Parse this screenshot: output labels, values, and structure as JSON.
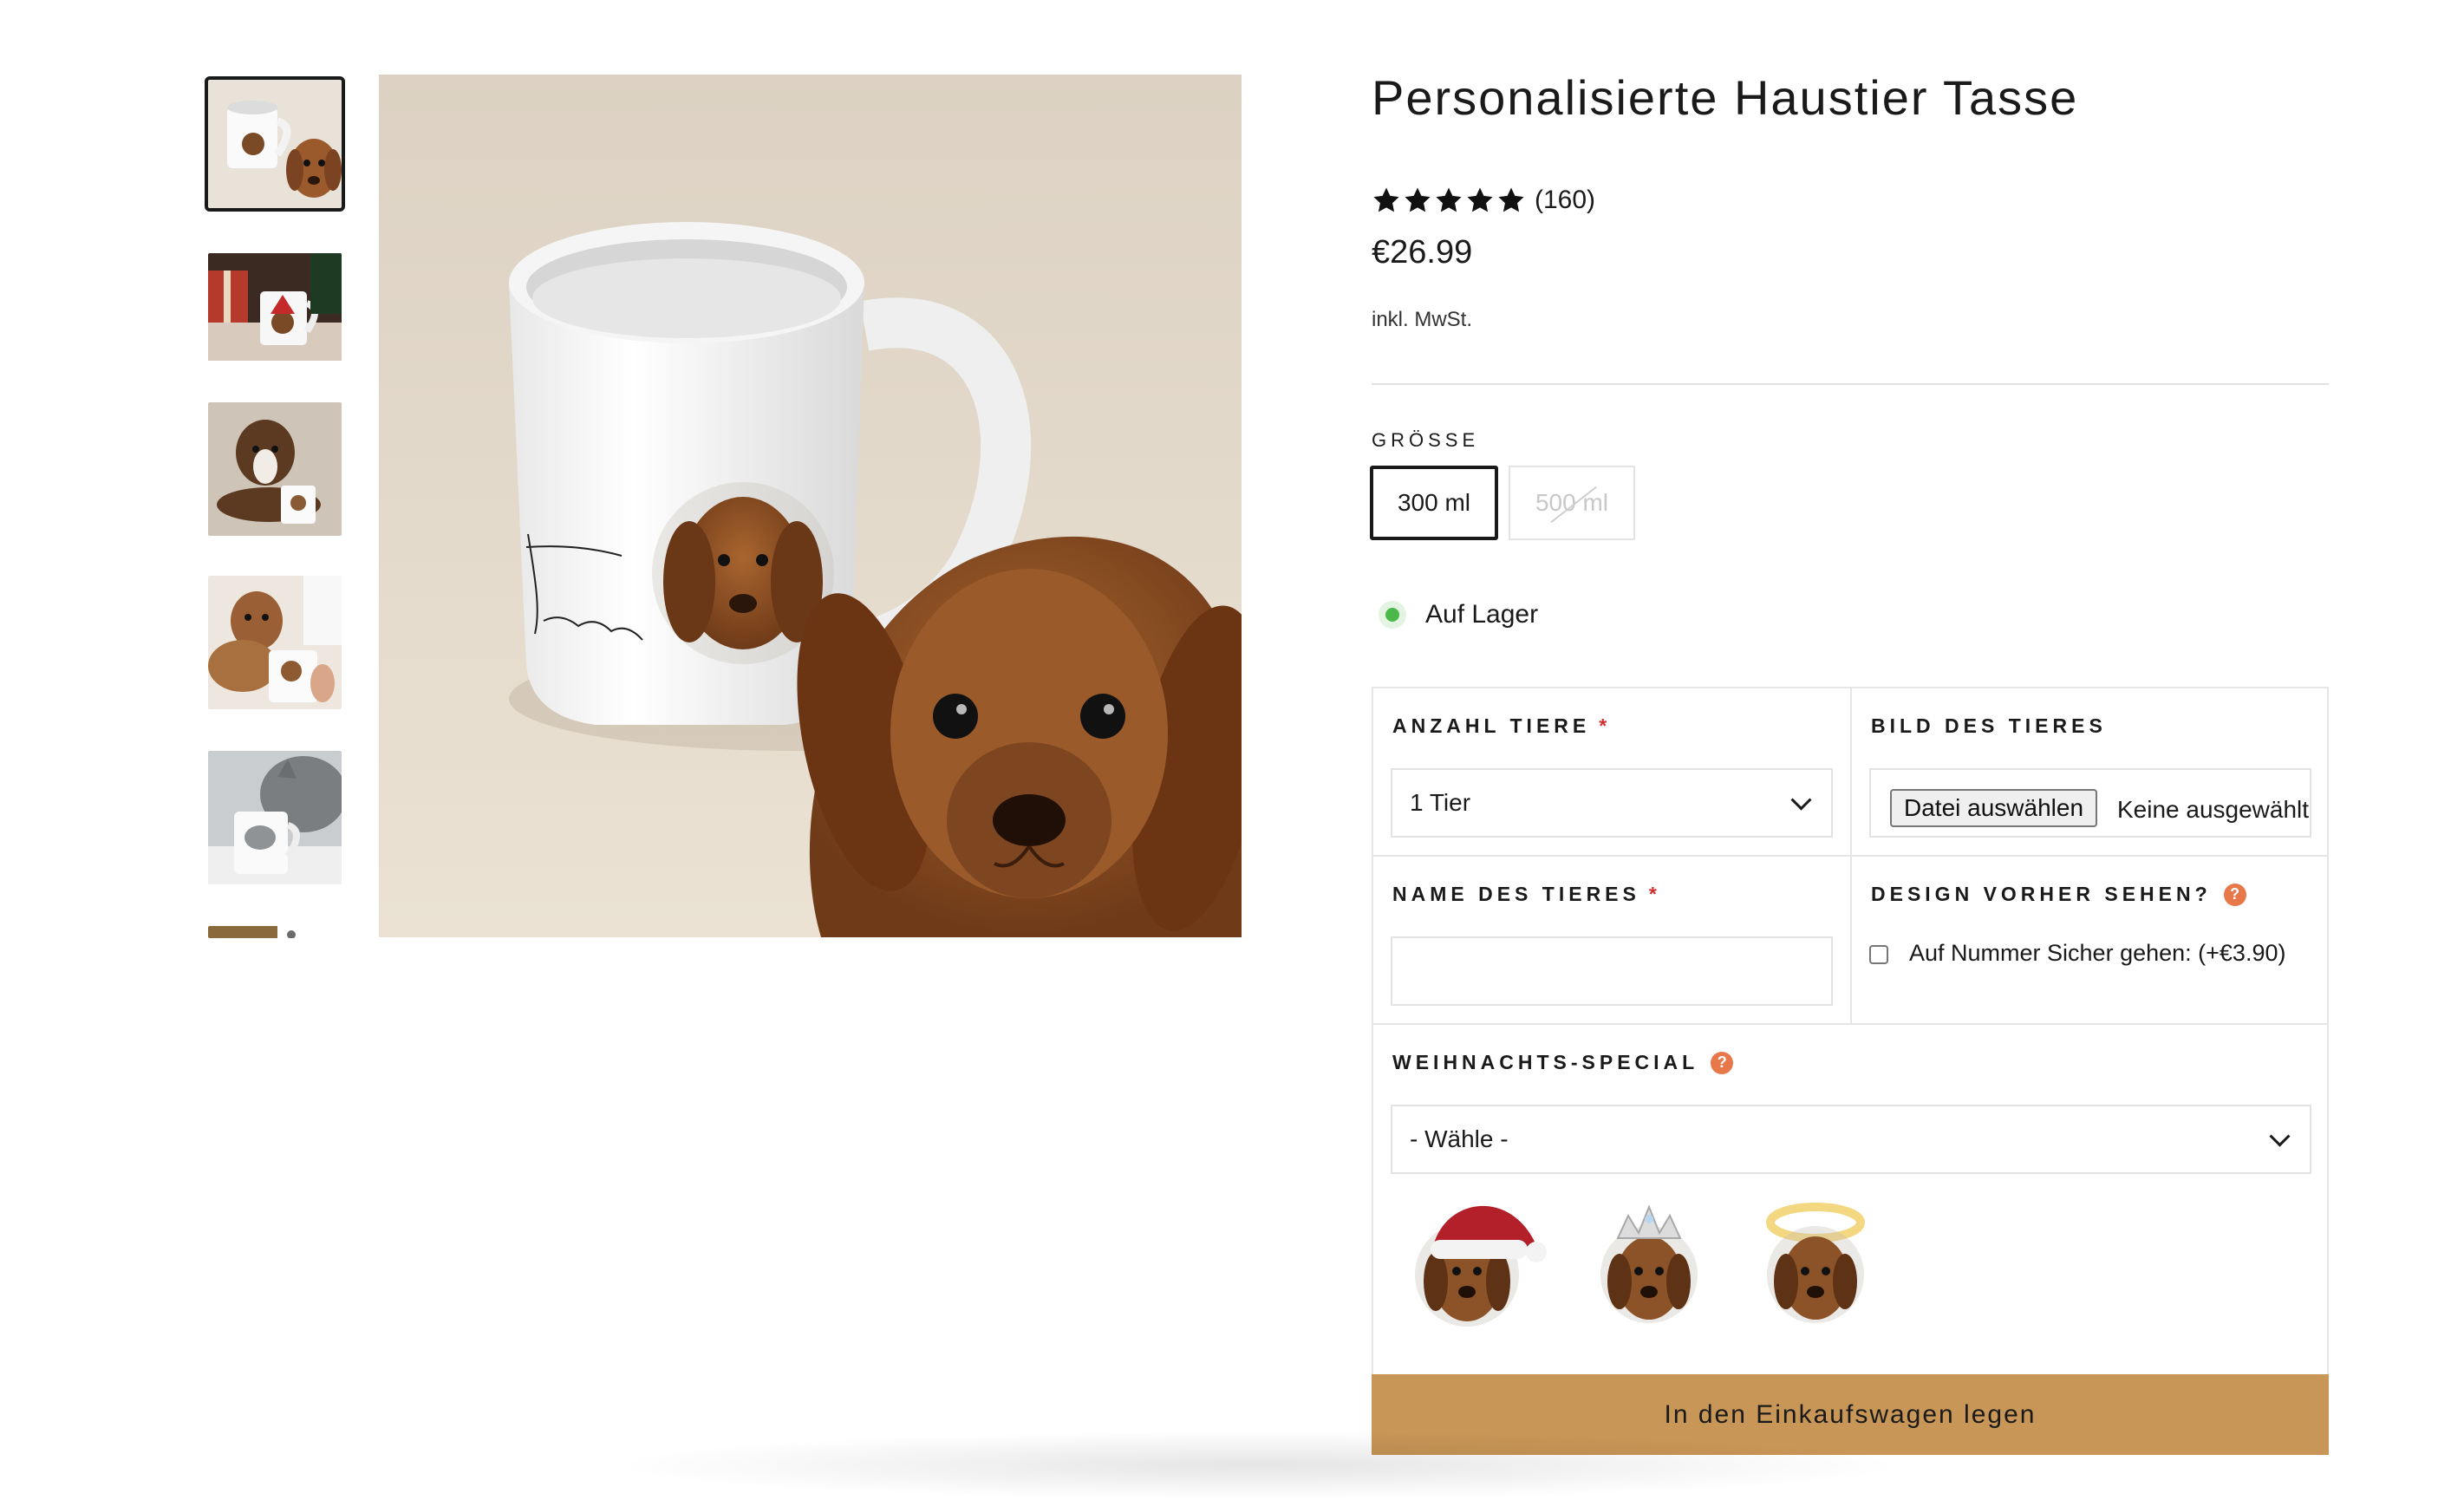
{
  "product": {
    "title": "Personalisierte Haustier Tasse",
    "rating": 5,
    "review_count": "(160)",
    "price": "€26.99",
    "tax_note": "inkl. MwSt."
  },
  "size": {
    "label": "GRÖSSE",
    "options": [
      {
        "label": "300 ml",
        "selected": true,
        "available": true
      },
      {
        "label": "500 ml",
        "selected": false,
        "available": false
      }
    ]
  },
  "stock": {
    "label": "Auf Lager",
    "color": "#4cb84a"
  },
  "options": {
    "pet_count": {
      "label": "ANZAHL TIERE",
      "required_mark": "*",
      "value": "1 Tier"
    },
    "pet_image": {
      "label": "BILD DES TIERES",
      "button_label": "Datei auswählen",
      "no_file_text": "Keine ausgewählt"
    },
    "pet_name": {
      "label": "NAME DES TIERES",
      "required_mark": "*",
      "value": ""
    },
    "preview": {
      "label": "DESIGN VORHER SEHEN?",
      "help_icon": "?",
      "checkbox_label": "Auf Nummer Sicher gehen: (+€3.90)",
      "checked": false
    },
    "christmas": {
      "label": "WEIHNACHTS-SPECIAL",
      "help_icon": "?",
      "value": "- Wähle -"
    }
  },
  "specials": [
    "santa-hat-icon",
    "tiara-icon",
    "halo-icon"
  ],
  "cart": {
    "label": "In den Einkaufswagen legen",
    "color": "#c89656"
  },
  "colors": {
    "accent": "#c89656",
    "required": "#d32f2f",
    "help": "#e8774a"
  }
}
